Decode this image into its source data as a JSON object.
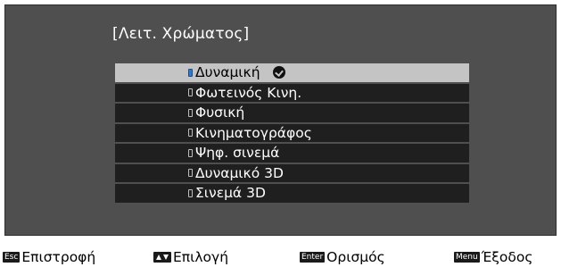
{
  "menu": {
    "title": "[Λειτ. Χρώματος]",
    "selected_index": 0,
    "options": [
      {
        "label": "Δυναμική",
        "selected": true
      },
      {
        "label": "Φωτεινός Κινη.",
        "selected": false
      },
      {
        "label": "Φυσική",
        "selected": false
      },
      {
        "label": "Κινηματογράφος",
        "selected": false
      },
      {
        "label": "Ψηφ. σινεμά",
        "selected": false
      },
      {
        "label": "Δυναμικό 3D",
        "selected": false
      },
      {
        "label": "Σινεμά 3D",
        "selected": false
      }
    ]
  },
  "footer": {
    "back": {
      "key": "Esc",
      "label": "Επιστροφή"
    },
    "select": {
      "key_icon": "up-down-arrows",
      "label": "Επιλογή"
    },
    "enter": {
      "key": "Enter",
      "label": "Ορισμός"
    },
    "exit": {
      "key": "Menu",
      "label": "Έξοδος"
    }
  },
  "colors": {
    "panel_bg": "#4f4f4f",
    "row_bg": "#1f1f1f",
    "selected_bg": "#c4c4c4",
    "radio_selected": "#2a7bd6"
  }
}
